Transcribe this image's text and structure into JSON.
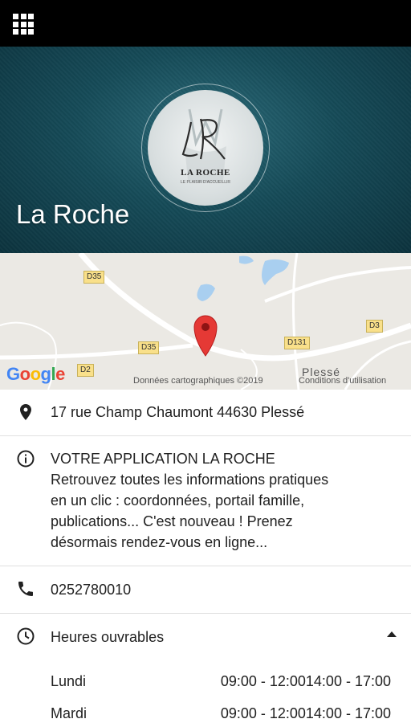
{
  "toolbar": {
    "menu_icon": "grid-menu-icon"
  },
  "hero": {
    "title": "La Roche",
    "logo": {
      "monogram": "LR",
      "name": "LA ROCHE",
      "tagline": "LE PLAISIR D'ACCUEILLIR"
    }
  },
  "map": {
    "road_labels": [
      "D35",
      "D35",
      "D131",
      "D3",
      "D2"
    ],
    "town_label": "Plessé",
    "google_logo": "Google",
    "data_credit": "Données cartographiques ©2019",
    "terms": "Conditions d'utilisation",
    "pin_icon": "map-pin-icon"
  },
  "address": {
    "icon": "location-pin-icon",
    "text": "17 rue Champ Chaumont 44630 Plessé"
  },
  "info": {
    "icon": "info-icon",
    "title": "VOTRE APPLICATION LA ROCHE",
    "lines": [
      "Retrouvez toutes les informations pratiques",
      "en un clic : coordonnées, portail famille,",
      "publications... C'est nouveau ! Prenez",
      "désormais rendez-vous en ligne..."
    ]
  },
  "phone": {
    "icon": "phone-icon",
    "text": "0252780010"
  },
  "hours": {
    "icon": "clock-icon",
    "label": "Heures ouvrables",
    "expanded": true,
    "days": [
      {
        "day": "Lundi",
        "time": "09:00 - 12:0014:00 - 17:00"
      },
      {
        "day": "Mardi",
        "time": "09:00 - 12:0014:00 - 17:00"
      }
    ]
  }
}
